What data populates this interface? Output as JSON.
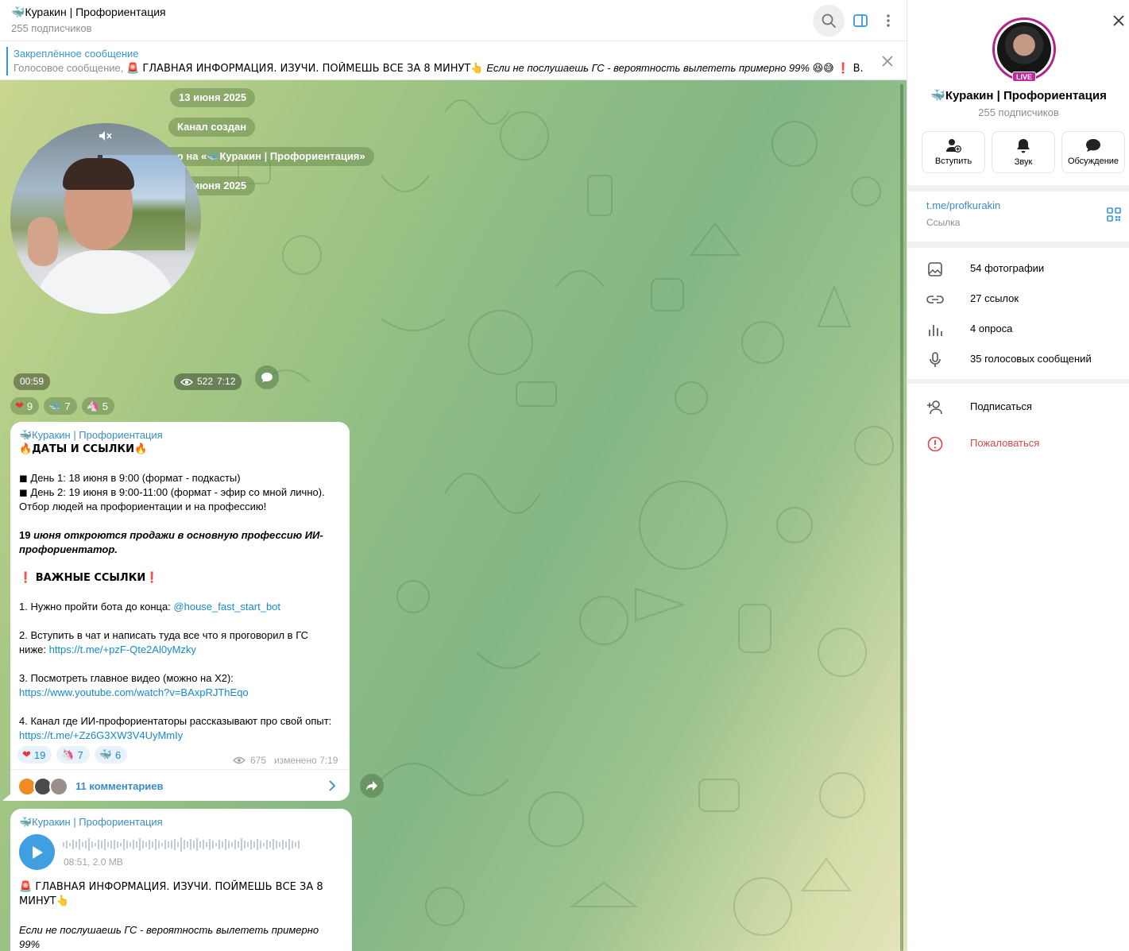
{
  "header": {
    "title": "🐳Куракин | Профориентация",
    "subscribers": "255 подписчиков"
  },
  "pinned": {
    "title": "Закреплённое сообщение",
    "kind": "Голосовое сообщение",
    "text": "🚨 ГЛАВНАЯ ИНФОРМАЦИЯ. ИЗУЧИ. ПОЙМЕШЬ ВСЕ ЗА 8 МИНУТ👆",
    "italic": "Если не послушаешь ГС - вероятность вылететь примерно 99% 😆😅",
    "tail": "❗ В..."
  },
  "service": {
    "date1": "13 июня 2025",
    "created": "Канал создан",
    "renamed": "Название канала изменено на «🐳Куракин | Профориентация»",
    "date2": "16 июня 2025"
  },
  "round_video": {
    "duration": "00:59",
    "views": "522",
    "time": "7:12",
    "reactions": [
      {
        "emoji": "❤",
        "count": "9"
      },
      {
        "emoji": "🐳",
        "count": "7"
      },
      {
        "emoji": "🦄",
        "count": "5"
      }
    ]
  },
  "post1": {
    "author": "🐳Куракин | Профориентация",
    "title": "🔥ДАТЫ И ССЫЛКИ🔥",
    "day1": "◼ День 1: 18 июня в 9:00 (формат - подкасты)",
    "day2": "◼ День 2: 19 июня в 9:00-11:00 (формат - эфир со мной лично).",
    "selection": "Отбор людей на профориентации и на профессию!",
    "sales_bold": "19",
    "sales_italic": " июня откроются продажи в основную профессию ИИ-профориентатор.",
    "links_title": "❗ ВАЖНЫЕ ССЫЛКИ❗",
    "item1_text": "1. Нужно пройти бота до конца: ",
    "item1_link": "@house_fast_start_bot",
    "item2_text": "2. Вступить в чат и написать туда все что я проговорил в ГС ниже: ",
    "item2_link": "https://t.me/+pzF-Qte2Al0yMzky",
    "item3_text": "3. Посмотреть главное видео (можно на Х2):",
    "item3_link": "https://www.youtube.com/watch?v=BAxpRJThEqo",
    "item4_text": "4. Канал где ИИ-профориентаторы рассказывают про свой опыт: ",
    "item4_link": "https://t.me/+Zz6G3XW3V4UyMmIy",
    "reactions": [
      {
        "emoji": "❤",
        "count": "19"
      },
      {
        "emoji": "🦄",
        "count": "7"
      },
      {
        "emoji": "🐳",
        "count": "6"
      }
    ],
    "views": "675",
    "edited": "изменено 7:19",
    "comments": "11 комментариев"
  },
  "post2": {
    "author": "🐳Куракин | Профориентация",
    "voice_meta": "08:51, 2.0 MB",
    "headline": "🚨 ГЛАВНАЯ ИНФОРМАЦИЯ. ИЗУЧИ. ПОЙМЕШЬ ВСЕ ЗА 8 МИНУТ👆",
    "italic": "Если не послушаешь ГС - вероятность вылететь примерно 99%",
    "emojis": "😆😅"
  },
  "side": {
    "live": "LIVE",
    "name": "🐳Куракин | Профориентация",
    "subscribers": "255 подписчиков",
    "actions": {
      "join": "Вступить",
      "sound": "Звук",
      "discuss": "Обсуждение"
    },
    "link": "t.me/profkurakin",
    "link_label": "Ссылка",
    "media": {
      "photos": "54 фотографии",
      "links": "27 ссылок",
      "polls": "4 опроса",
      "voice": "35 голосовых сообщений"
    },
    "subscribe": "Подписаться",
    "report": "Пожаловаться"
  },
  "colors": {
    "accent": "#3a8cc8",
    "danger": "#d54848",
    "live": "#c2279c"
  }
}
